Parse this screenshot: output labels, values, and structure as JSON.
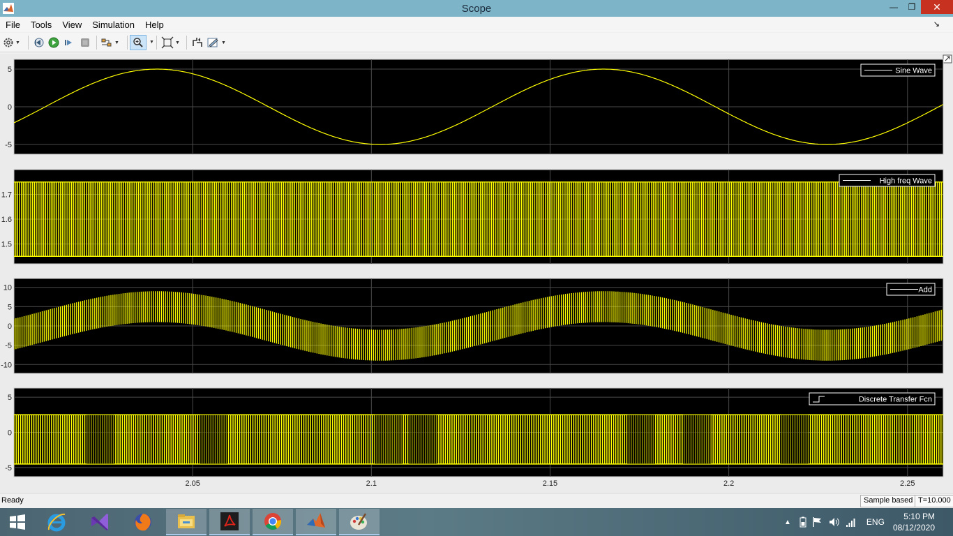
{
  "window": {
    "title": "Scope"
  },
  "menu": [
    "File",
    "Tools",
    "View",
    "Simulation",
    "Help"
  ],
  "toolbar": {
    "buttons": [
      "settings-icon",
      "step-back-icon",
      "run-icon",
      "step-forward-icon",
      "stop-icon",
      "highlight-icon",
      "zoom-in-icon",
      "autoscale-icon",
      "triggers-icon",
      "style-icon"
    ],
    "active": "zoom-in-icon"
  },
  "axes": {
    "x_ticks": [
      "2.05",
      "2.1",
      "2.15",
      "2.2",
      "2.25"
    ]
  },
  "panels": [
    {
      "legend": "Sine Wave",
      "y_ticks": [
        "5",
        "0",
        "-5"
      ]
    },
    {
      "legend": "High freq Wave",
      "y_ticks": [
        "1.7",
        "1.6",
        "1.5"
      ]
    },
    {
      "legend": "Add",
      "y_ticks": [
        "10",
        "5",
        "0",
        "-5",
        "-10"
      ]
    },
    {
      "legend": "Discrete Transfer Fcn",
      "y_ticks": [
        "5",
        "0",
        "-5"
      ]
    }
  ],
  "chart_data": [
    {
      "type": "line",
      "title": "",
      "xlabel": "",
      "ylabel": "",
      "xlim": [
        2.0,
        2.26
      ],
      "ylim": [
        -6.3,
        6.3
      ],
      "grid": true,
      "legend_position": "top-right",
      "series": [
        {
          "name": "Sine Wave",
          "color": "#ffff00",
          "amplitude": 5,
          "frequency_hz": 8,
          "peak_at_x": 2.04
        }
      ]
    },
    {
      "type": "line",
      "title": "",
      "xlabel": "",
      "ylabel": "",
      "xlim": [
        2.0,
        2.26
      ],
      "ylim": [
        1.42,
        1.8
      ],
      "grid": true,
      "legend_position": "top-right",
      "series": [
        {
          "name": "High freq Wave",
          "color": "#ffff00",
          "min": 1.45,
          "max": 1.75,
          "oscillation": "high-frequency"
        }
      ]
    },
    {
      "type": "line",
      "title": "",
      "xlabel": "",
      "ylabel": "",
      "xlim": [
        2.0,
        2.26
      ],
      "ylim": [
        -12.3,
        12.3
      ],
      "grid": true,
      "legend_position": "top-right",
      "series": [
        {
          "name": "Add",
          "color": "#ffff00",
          "envelope_center": "5*sin",
          "band_half_width": 4
        }
      ]
    },
    {
      "type": "line",
      "title": "",
      "xlabel": "",
      "ylabel": "",
      "xlim": [
        2.0,
        2.26
      ],
      "ylim": [
        -6.3,
        6.3
      ],
      "grid": true,
      "legend_position": "top-right",
      "series": [
        {
          "name": "Discrete Transfer Fcn",
          "color": "#ffff00",
          "min": -4.5,
          "max": 2.5,
          "style": "stairs"
        }
      ]
    }
  ],
  "status": {
    "text": "Ready",
    "mode": "Sample based",
    "time": "T=10.000"
  },
  "taskbar": {
    "apps": [
      "windows-start-icon",
      "internet-explorer-icon",
      "visual-studio-icon",
      "firefox-icon",
      "file-explorer-icon",
      "acrobat-icon",
      "chrome-icon",
      "matlab-icon",
      "paint-icon"
    ],
    "language": "ENG",
    "time": "5:10 PM",
    "date": "08/12/2020"
  }
}
